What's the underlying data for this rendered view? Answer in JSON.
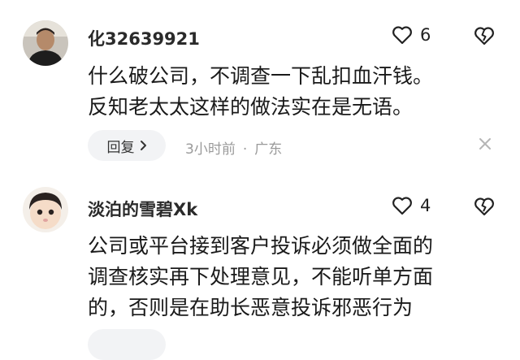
{
  "comments": [
    {
      "username": "化32639921",
      "likes": "6",
      "lines": [
        "什么破公司，不调查一下乱扣血汗钱。",
        "反知老太太这样的做法实在是无语。"
      ],
      "reply_label": "回复",
      "time": "3小时前",
      "separator": "·",
      "location": "广东",
      "avatar_icon": "user-photo-man",
      "icons": [
        "heart-outline-icon",
        "broken-heart-icon",
        "close-icon",
        "chevron-right-icon"
      ]
    },
    {
      "username": "淡泊的雪碧Xk",
      "likes": "4",
      "lines": [
        "公司或平台接到客户投诉必须做全面的",
        "调查核实再下处理意见，不能听单方面",
        "的，否则是在助长恶意投诉邪恶行为"
      ],
      "avatar_icon": "user-photo-child",
      "icons": [
        "heart-outline-icon",
        "broken-heart-icon"
      ]
    }
  ],
  "colors": {
    "text": "#1a1a1a",
    "meta": "#9a9a9a",
    "reply_bg": "#f2f3f5"
  }
}
